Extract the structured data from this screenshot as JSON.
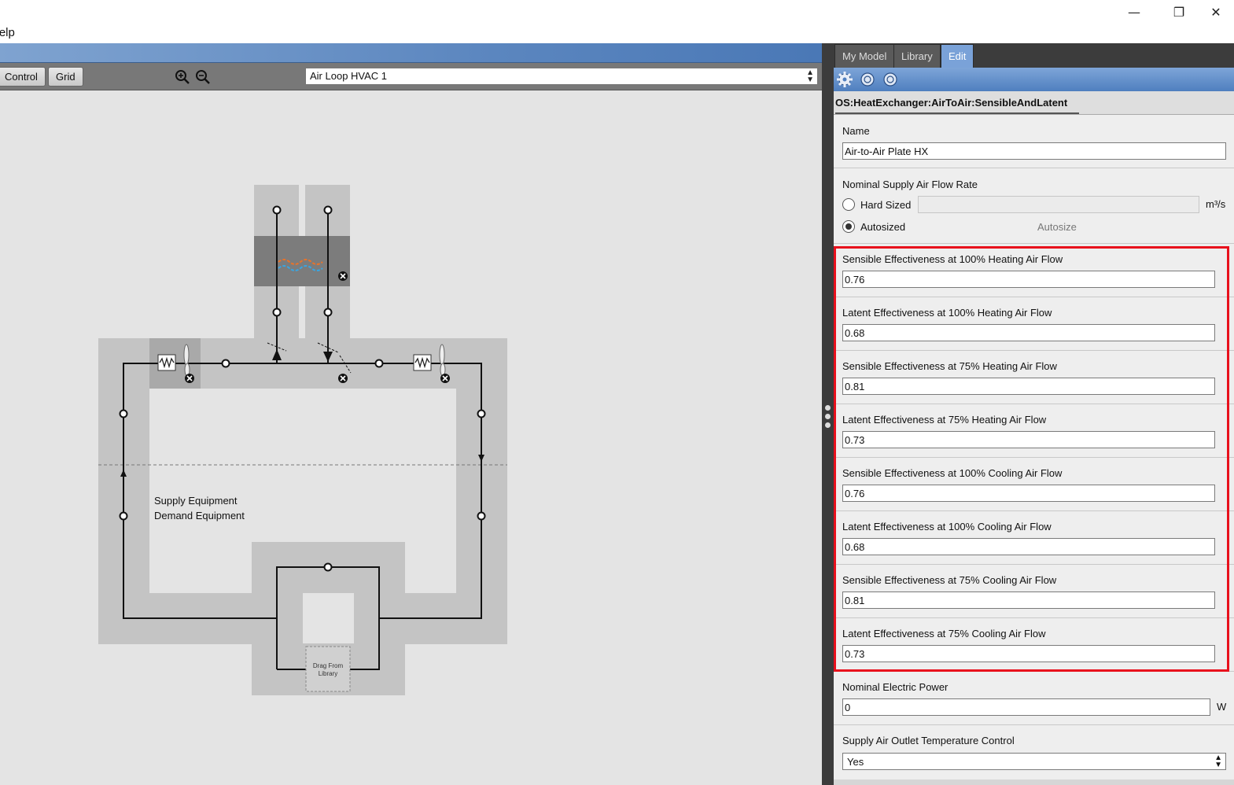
{
  "window": {
    "minimize": "—",
    "restore": "❐",
    "close": "✕"
  },
  "menu": {
    "help": "Help"
  },
  "toolbar": {
    "control_label": "Control",
    "grid_label": "Grid",
    "loop_select_value": "Air Loop HVAC 1"
  },
  "canvas": {
    "supply_label": "Supply Equipment",
    "demand_label": "Demand Equipment",
    "drag_line1": "Drag From",
    "drag_line2": "Library"
  },
  "tabs": [
    {
      "label": "My Model"
    },
    {
      "label": "Library"
    },
    {
      "label": "Edit"
    }
  ],
  "inspector": {
    "object_type": "OS:HeatExchanger:AirToAir:SensibleAndLatent",
    "name_label": "Name",
    "name_value": "Air-to-Air Plate HX",
    "supply_flow_label": "Nominal Supply Air Flow Rate",
    "hard_sized_label": "Hard Sized",
    "autosized_label": "Autosized",
    "autosize_value": "Autosize",
    "flow_unit": "m³/s",
    "effectiveness_fields": [
      {
        "label": "Sensible Effectiveness at 100% Heating Air Flow",
        "value": "0.76"
      },
      {
        "label": "Latent Effectiveness at 100% Heating Air Flow",
        "value": "0.68"
      },
      {
        "label": "Sensible Effectiveness at 75% Heating Air Flow",
        "value": "0.81"
      },
      {
        "label": "Latent Effectiveness at 75% Heating Air Flow",
        "value": "0.73"
      },
      {
        "label": "Sensible Effectiveness at 100% Cooling Air Flow",
        "value": "0.76"
      },
      {
        "label": "Latent Effectiveness at 100% Cooling Air Flow",
        "value": "0.68"
      },
      {
        "label": "Sensible Effectiveness at 75% Cooling Air Flow",
        "value": "0.81"
      },
      {
        "label": "Latent Effectiveness at 75% Cooling Air Flow",
        "value": "0.73"
      }
    ],
    "electric_power_label": "Nominal Electric Power",
    "electric_power_value": "0",
    "electric_power_unit": "W",
    "outlet_temp_label": "Supply Air Outlet Temperature Control",
    "outlet_temp_value": "Yes"
  },
  "colors": {
    "accent_blue": "#7aa2d8",
    "highlight_red": "#e8101c",
    "hx_warm": "#e8732a",
    "hx_cool": "#3aa5e0"
  }
}
